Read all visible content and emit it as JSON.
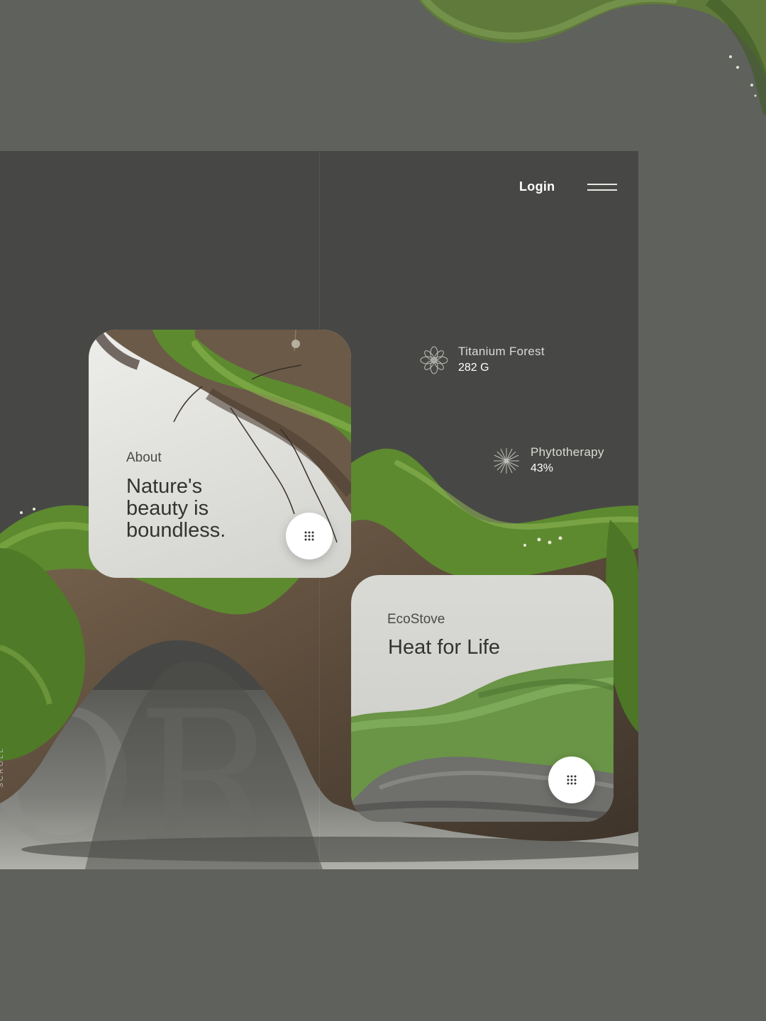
{
  "header": {
    "login_label": "Login"
  },
  "stats": [
    {
      "label": "Titanium Forest",
      "value": "282 G",
      "icon": "flower-spiral-icon"
    },
    {
      "label": "Phytotherapy",
      "value": "43%",
      "icon": "burst-rays-icon"
    }
  ],
  "side": {
    "scroll_label": "SCROLL"
  },
  "cards": {
    "about": {
      "kicker": "About",
      "title": "Nature's beauty is boundless."
    },
    "eco": {
      "kicker": "EcoStove",
      "title": "Heat for Life"
    }
  },
  "colors": {
    "page_bg": "#5f615d",
    "frame_bg": "#474845",
    "moss": "#5d8a2f",
    "bark": "#6b5a48"
  }
}
